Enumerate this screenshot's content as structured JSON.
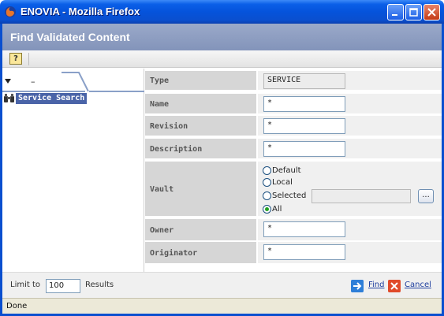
{
  "window": {
    "title": "ENOVIA - Mozilla Firefox"
  },
  "header": {
    "title": "Find Validated Content"
  },
  "toolbar": {
    "help_label": "?"
  },
  "sidebar": {
    "tab_label": "–",
    "search_item": "Service Search"
  },
  "form": {
    "type": {
      "label": "Type",
      "value": "SERVICE"
    },
    "name": {
      "label": "Name",
      "value": "*"
    },
    "revision": {
      "label": "Revision",
      "value": "*"
    },
    "description": {
      "label": "Description",
      "value": "*"
    },
    "vault": {
      "label": "Vault",
      "options": [
        "Default",
        "Local",
        "Selected",
        "All"
      ],
      "selected": "All",
      "ellipsis": "..."
    },
    "owner": {
      "label": "Owner",
      "value": "*"
    },
    "originator": {
      "label": "Originator",
      "value": "*"
    }
  },
  "footer": {
    "limit_label": "Limit to",
    "limit_value": "100",
    "results_label": "Results",
    "find_label": "Find",
    "cancel_label": "Cancel"
  },
  "status": {
    "text": "Done"
  }
}
